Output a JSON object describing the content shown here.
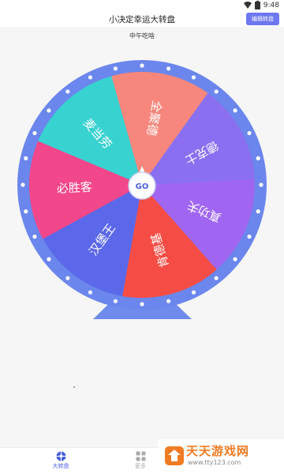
{
  "status_bar": {
    "time": "9:48"
  },
  "header": {
    "title": "小决定幸运大转盘",
    "edit_button": "编辑转盘"
  },
  "wheel": {
    "question": "中午吃啥",
    "go_label": "GO",
    "segments": [
      {
        "label": "全聚德",
        "color": "#f7877c"
      },
      {
        "label": "德克士",
        "color": "#8a70f0"
      },
      {
        "label": "真功夫",
        "color": "#a066f2"
      },
      {
        "label": "肯德基",
        "color": "#f54d45"
      },
      {
        "label": "汉堡王",
        "color": "#5c68ea"
      },
      {
        "label": "必胜客",
        "color": "#f2478a"
      },
      {
        "label": "麦当劳",
        "color": "#38d2d0"
      }
    ],
    "colors": {
      "rim": "#6b86ec",
      "stand": "#6f8bec",
      "rim_dots": "#ffffff"
    }
  },
  "tabs": [
    {
      "label": "大转盘",
      "icon": "wheel-icon",
      "active": true
    },
    {
      "label": "更多",
      "icon": "grid-icon",
      "active": false
    }
  ],
  "watermark": {
    "text": "天天游戏网",
    "url": "www.tty123.com"
  }
}
